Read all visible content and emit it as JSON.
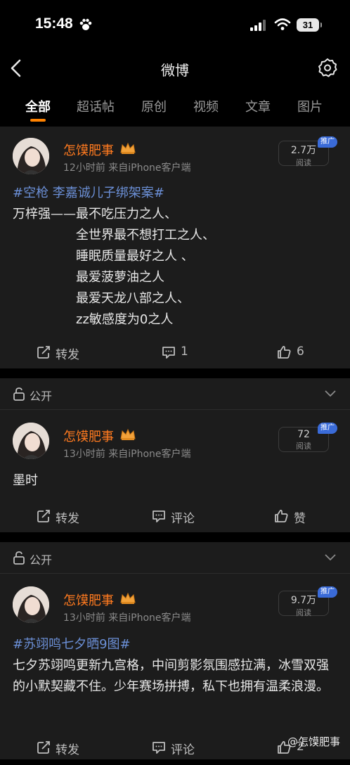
{
  "status_bar": {
    "time": "15:48",
    "battery": "31"
  },
  "nav": {
    "title": "微博"
  },
  "tabs": [
    {
      "label": "全部",
      "active": true
    },
    {
      "label": "超话帖",
      "active": false
    },
    {
      "label": "原创",
      "active": false
    },
    {
      "label": "视频",
      "active": false
    },
    {
      "label": "文章",
      "active": false
    },
    {
      "label": "图片",
      "active": false
    }
  ],
  "posts": [
    {
      "username": "怎馍肥事",
      "meta": "12小时前  来自iPhone客户端",
      "reads_count": "2.7万",
      "reads_label": "阅读",
      "promo": "推广",
      "topic": "#空枪 李嘉诚儿子绑架案#",
      "lines": [
        "万梓强——最不吃压力之人、",
        "全世界最不想打工之人、",
        "睡眠质量最好之人 、",
        "最爱菠萝油之人",
        "最爱天龙八部之人、",
        "zz敏感度为0之人"
      ],
      "repost": "转发",
      "comment": "1",
      "like": "6"
    },
    {
      "public_label": "公开",
      "username": "怎馍肥事",
      "meta": "13小时前  来自iPhone客户端",
      "reads_count": "72",
      "reads_label": "阅读",
      "promo": "推广",
      "text": "墨时",
      "repost": "转发",
      "comment": "评论",
      "like": "赞"
    },
    {
      "public_label": "公开",
      "username": "怎馍肥事",
      "meta": "13小时前  来自iPhone客户端",
      "reads_count": "9.7万",
      "reads_label": "阅读",
      "promo": "推广",
      "topic": "#苏翊鸣七夕晒9图#",
      "text": "七夕苏翊鸣更新九宫格，中间剪影氛围感拉满，冰雪双强的小默契藏不住。少年赛场拼搏，私下也拥有温柔浪漫。",
      "repost": "转发",
      "comment": "评论",
      "like": "2"
    }
  ],
  "watermark": "@怎馍肥事",
  "colors": {
    "accent": "#ff8200",
    "username": "#ff7a1f",
    "topic": "#6b8fd6",
    "promo": "#3a6bd8",
    "card": "#1c1c1c"
  }
}
